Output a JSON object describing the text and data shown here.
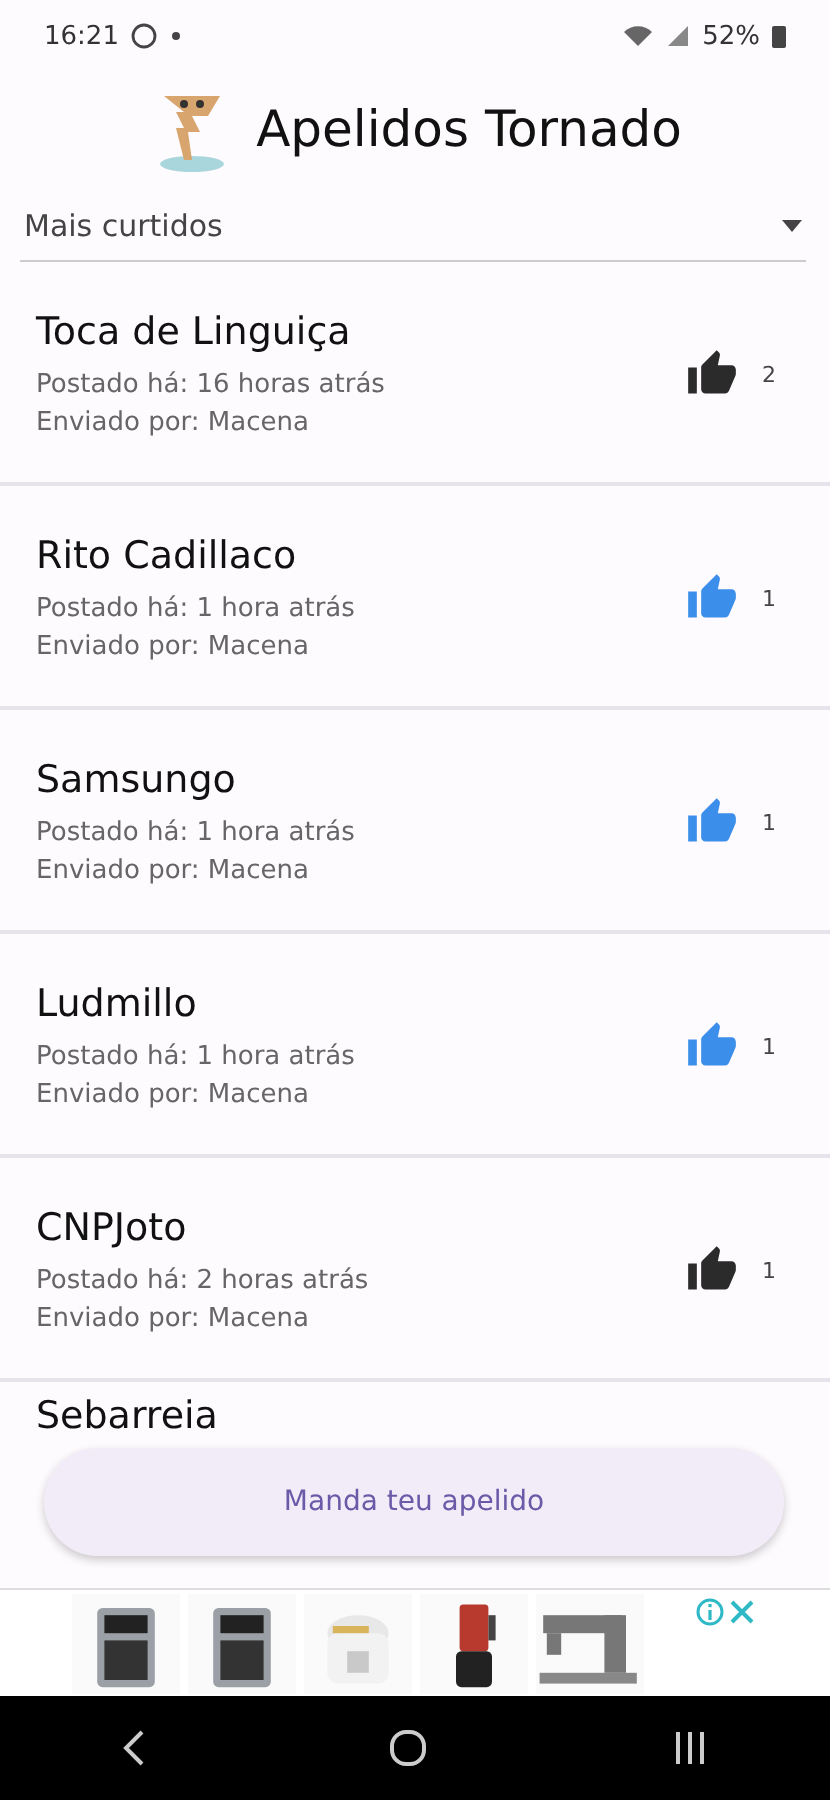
{
  "status_bar": {
    "time": "16:21",
    "battery": "52%"
  },
  "app_bar": {
    "title": "Apelidos Tornado"
  },
  "sort_dropdown": {
    "value": "Mais curtidos"
  },
  "posts": [
    {
      "title": "Toca de Linguiça",
      "posted": "Postado há: 16 horas atrás",
      "sender": "Enviado por: Macena",
      "liked": false,
      "likes": "2"
    },
    {
      "title": "Rito Cadillaco",
      "posted": "Postado há: 1 hora atrás",
      "sender": "Enviado por: Macena",
      "liked": true,
      "likes": "1"
    },
    {
      "title": "Samsungo",
      "posted": "Postado há: 1 hora atrás",
      "sender": "Enviado por: Macena",
      "liked": true,
      "likes": "1"
    },
    {
      "title": "Ludmillo",
      "posted": "Postado há: 1 hora atrás",
      "sender": "Enviado por: Macena",
      "liked": true,
      "likes": "1"
    },
    {
      "title": "CNPJoto",
      "posted": "Postado há: 2 horas atrás",
      "sender": "Enviado por: Macena",
      "liked": false,
      "likes": "1"
    }
  ],
  "partial_post": {
    "title": "Sebarreia"
  },
  "fab": {
    "label": "Manda teu apelido"
  },
  "ad_banner": {
    "products": [
      {
        "kind": "oven"
      },
      {
        "kind": "oven"
      },
      {
        "kind": "cooker"
      },
      {
        "kind": "blender"
      },
      {
        "kind": "sewing"
      }
    ]
  }
}
